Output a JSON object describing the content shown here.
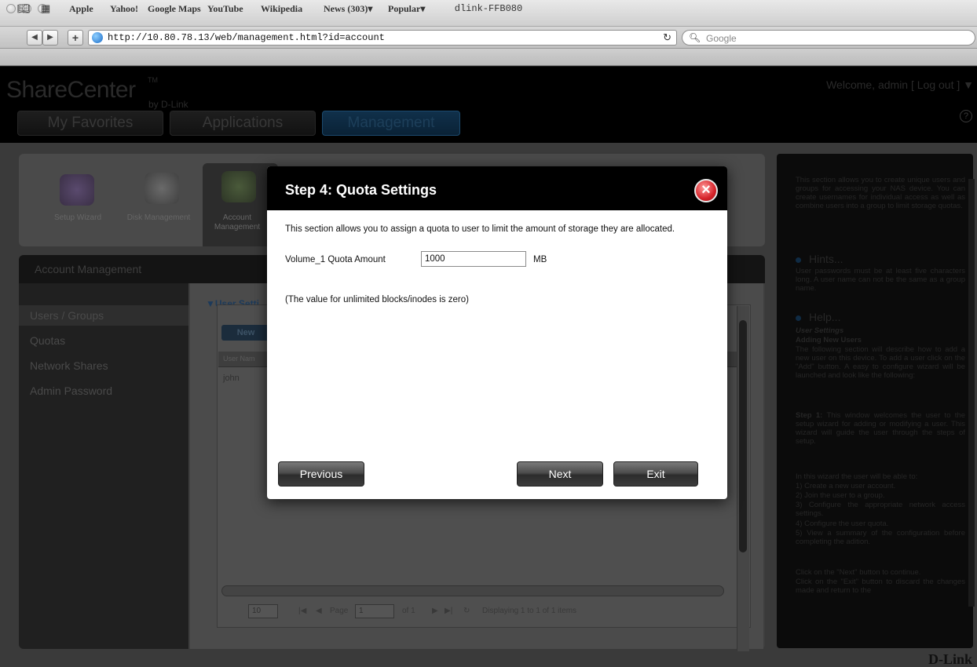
{
  "window": {
    "title": "dlink-FFB080"
  },
  "browser": {
    "url": "http://10.80.78.13/web/management.html?id=account",
    "search_placeholder": "Google",
    "bookmarks": [
      "Apple",
      "Yahoo!",
      "Google Maps",
      "YouTube",
      "Wikipedia",
      "News (303)▾",
      "Popular▾"
    ]
  },
  "header": {
    "logo": "ShareCenter",
    "logo_tm": "TM",
    "logo_by": "by D-Link",
    "welcome": "Welcome, admin [ Log out ] ▼",
    "help": "?",
    "tabs": [
      {
        "label": "My Favorites",
        "active": false
      },
      {
        "label": "Applications",
        "active": false
      },
      {
        "label": "Management",
        "active": true
      }
    ]
  },
  "features": [
    {
      "label": "Setup Wizard",
      "icon": "wand-icon"
    },
    {
      "label": "Disk Management",
      "icon": "disk-icon"
    },
    {
      "label": "Account Management",
      "icon": "people-gear-icon"
    }
  ],
  "account": {
    "title": "Account Management",
    "sidebar": [
      "Users / Groups",
      "Quotas",
      "Network Shares",
      "Admin Password"
    ],
    "section_title": "User Setti",
    "new_button": "New",
    "column_header": "User Nam",
    "rows": [
      "john"
    ],
    "pager": {
      "page_size": "10",
      "page_label": "Page",
      "page": "1",
      "of": "of 1",
      "status": "Displaying 1 to 1 of 1 items"
    }
  },
  "help": {
    "intro": "This section allows you to create unique users and groups for accessing your NAS device. You can create usernames for individual access as well as combine users into a group to limit storage quotas.",
    "hints_title": "Hints...",
    "hints_text": "User passwords must be at least five characters long. A user name can not be the same as a group name.",
    "help_title": "Help...",
    "help_subtitle": "User Settings",
    "help_heading": "Adding New Users",
    "help_p1": "The following section will describe how to add a new user on this device. To add a user click on the \"Add\" button. A easy to configure wizard will be launched and look like the following:",
    "step1_label": "Step 1:",
    "step1_text": "This window welcomes the user to the setup wizard for adding or modifying a user. This wizard will guide the user through the steps of setup.",
    "list_intro": "In this wizard the user will be able to:",
    "list": [
      "1) Create a new user account.",
      "2) Join the user to a group.",
      "3) Configure the appropriate network access settings.",
      "4) Configure the user quota.",
      "5) View a summary of the configuration before completing the adition."
    ],
    "next_text": "Click on the \"Next\" button to continue.",
    "exit_text": "Click on the \"Exit\" button to discard the changes made and return to the"
  },
  "footer_logo": "D-Link",
  "modal": {
    "title": "Step 4: Quota Settings",
    "description": "This section allows you to assign a quota to user to limit the amount of storage they are allocated.",
    "quota_label": "Volume_1 Quota Amount",
    "quota_value": "1000",
    "quota_unit": "MB",
    "note": "(The value for unlimited blocks/inodes is zero)",
    "buttons": {
      "previous": "Previous",
      "next": "Next",
      "exit": "Exit"
    }
  }
}
